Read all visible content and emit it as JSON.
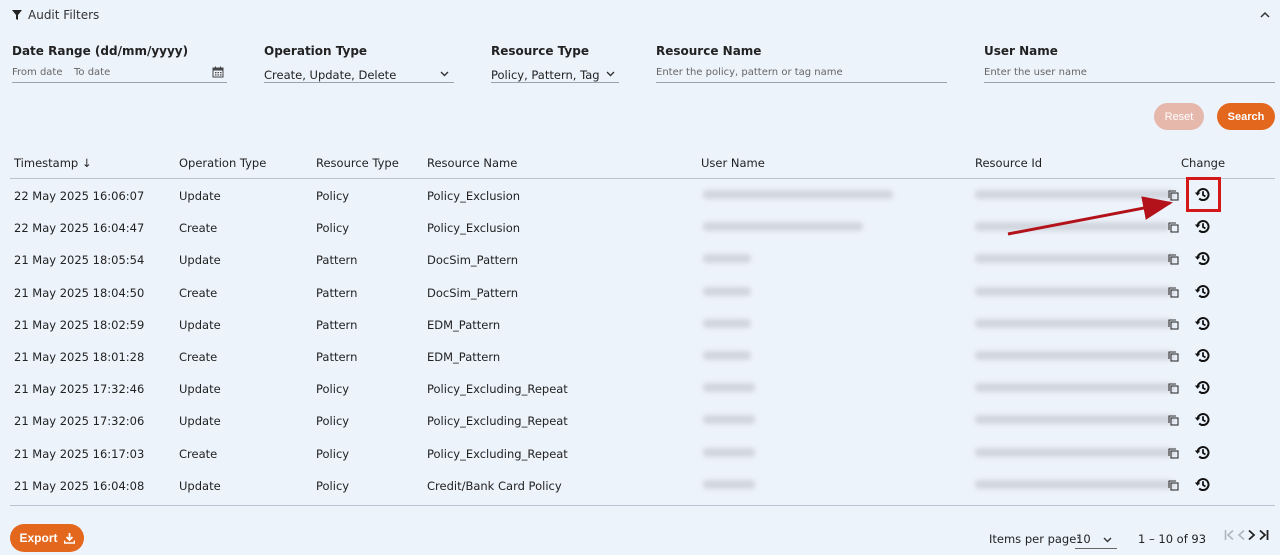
{
  "filters": {
    "title": "Audit Filters",
    "date_range": {
      "label": "Date Range (dd/mm/yyyy)",
      "from_placeholder": "From date",
      "to_placeholder": "To date"
    },
    "operation_type": {
      "label": "Operation Type",
      "value": "Create, Update, Delete"
    },
    "resource_type": {
      "label": "Resource Type",
      "value": "Policy, Pattern, Tag"
    },
    "resource_name": {
      "label": "Resource Name",
      "placeholder": "Enter the policy, pattern or tag name"
    },
    "user_name": {
      "label": "User Name",
      "placeholder": "Enter the user name"
    },
    "reset_label": "Reset",
    "search_label": "Search"
  },
  "table": {
    "columns": {
      "timestamp": "Timestamp",
      "timestamp_sort": "↓",
      "operation_type": "Operation Type",
      "resource_type": "Resource Type",
      "resource_name": "Resource Name",
      "user_name": "User Name",
      "resource_id": "Resource Id",
      "change": "Change"
    },
    "rows": [
      {
        "timestamp": "22 May 2025 16:06:07",
        "operation": "Update",
        "resource_type": "Policy",
        "resource_name": "Policy_Exclusion"
      },
      {
        "timestamp": "22 May 2025 16:04:47",
        "operation": "Create",
        "resource_type": "Policy",
        "resource_name": "Policy_Exclusion"
      },
      {
        "timestamp": "21 May 2025 18:05:54",
        "operation": "Update",
        "resource_type": "Pattern",
        "resource_name": "DocSim_Pattern"
      },
      {
        "timestamp": "21 May 2025 18:04:50",
        "operation": "Create",
        "resource_type": "Pattern",
        "resource_name": "DocSim_Pattern"
      },
      {
        "timestamp": "21 May 2025 18:02:59",
        "operation": "Update",
        "resource_type": "Pattern",
        "resource_name": "EDM_Pattern"
      },
      {
        "timestamp": "21 May 2025 18:01:28",
        "operation": "Create",
        "resource_type": "Pattern",
        "resource_name": "EDM_Pattern"
      },
      {
        "timestamp": "21 May 2025 17:32:46",
        "operation": "Update",
        "resource_type": "Policy",
        "resource_name": "Policy_Excluding_Repeat"
      },
      {
        "timestamp": "21 May 2025 17:32:06",
        "operation": "Update",
        "resource_type": "Policy",
        "resource_name": "Policy_Excluding_Repeat"
      },
      {
        "timestamp": "21 May 2025 16:17:03",
        "operation": "Create",
        "resource_type": "Policy",
        "resource_name": "Policy_Excluding_Repeat"
      },
      {
        "timestamp": "21 May 2025 16:04:08",
        "operation": "Update",
        "resource_type": "Policy",
        "resource_name": "Credit/Bank Card Policy"
      }
    ]
  },
  "footer": {
    "export_label": "Export",
    "items_per_page_label": "Items per page:",
    "items_per_page_value": "10",
    "range_label": "1 – 10 of 93"
  },
  "colors": {
    "accent": "#e4671e",
    "accent_disabled": "#e6b7ab",
    "highlight": "#d41818",
    "background": "#edf3fb"
  },
  "icons": [
    "filter-icon",
    "chevron-up-icon",
    "calendar-icon",
    "chevron-down-icon",
    "sort-down-icon",
    "copy-icon",
    "history-icon",
    "download-icon",
    "first-page-icon",
    "prev-page-icon",
    "next-page-icon",
    "last-page-icon"
  ]
}
